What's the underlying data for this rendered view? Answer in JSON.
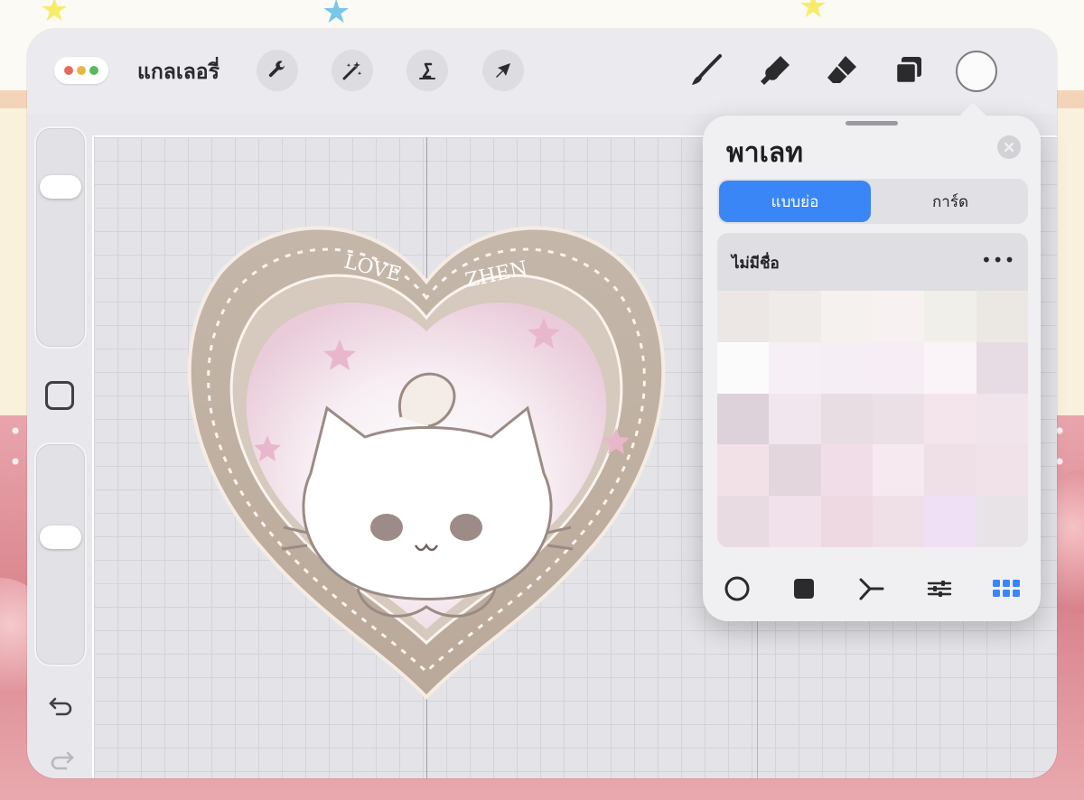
{
  "colors": {
    "accent": "#3a86f7",
    "window_dots": [
      "#e86a5e",
      "#e9b64a",
      "#5ab95e"
    ]
  },
  "toolbar": {
    "window_menu_icon": "three-dots-icon",
    "gallery_label": "แกลเลอรี่",
    "actions": [
      {
        "name": "actions-button",
        "icon": "wrench-icon"
      },
      {
        "name": "adjustments-button",
        "icon": "magic-wand-icon"
      },
      {
        "name": "selection-button",
        "icon": "selection-s-icon"
      },
      {
        "name": "transform-button",
        "icon": "arrow-cursor-icon"
      }
    ],
    "tools": [
      {
        "name": "brush-tool",
        "icon": "brush-icon"
      },
      {
        "name": "smudge-tool",
        "icon": "smudge-icon"
      },
      {
        "name": "eraser-tool",
        "icon": "eraser-icon"
      },
      {
        "name": "layers-tool",
        "icon": "layers-icon"
      }
    ],
    "current_color": "#fbfbfb"
  },
  "sidebar": {
    "brush_size_level": 0.55,
    "opacity_level": 0.2,
    "modify_icon": "square-modify-icon",
    "undo_icon": "undo-icon",
    "redo_icon": "redo-icon"
  },
  "palette_panel": {
    "title": "พาเลท",
    "close_icon": "close-icon",
    "view_tabs": [
      {
        "label": "แบบย่อ",
        "active": true
      },
      {
        "label": "การ์ด",
        "active": false
      }
    ],
    "palette_name": "ไม่มีชื่อ",
    "more_label": "•••",
    "swatches": [
      "#ece7e4",
      "#efebe8",
      "#f5f1ef",
      "#f7f2f1",
      "#f1efea",
      "#ebe8e4",
      "#fbfbfc",
      "#f6eff5",
      "#f5eef4",
      "#f7eef5",
      "#faf4f8",
      "#e8dce4",
      "#ddd2da",
      "#f1e6ed",
      "#e9dde4",
      "#ebe0e6",
      "#f4e5ec",
      "#f1e4ea",
      "#f3e1e8",
      "#e3d6dd",
      "#f1dde7",
      "#f6eaf0",
      "#eee0e6",
      "#f1e2e9",
      "#e8dbe1",
      "#f1e1ea",
      "#eed9e2",
      "#efdfe6",
      "#efe0f5",
      "#e8e3e6"
    ],
    "color_modes": [
      {
        "name": "disc-mode",
        "icon": "circle-outline-icon"
      },
      {
        "name": "classic-mode",
        "icon": "filled-square-icon"
      },
      {
        "name": "harmony-mode",
        "icon": "harmony-icon"
      },
      {
        "name": "value-mode",
        "icon": "sliders-icon"
      },
      {
        "name": "palettes-mode",
        "icon": "grid-icon",
        "active": true
      }
    ]
  },
  "artwork": {
    "lettering": [
      "LOVE",
      "ZHEN"
    ]
  }
}
